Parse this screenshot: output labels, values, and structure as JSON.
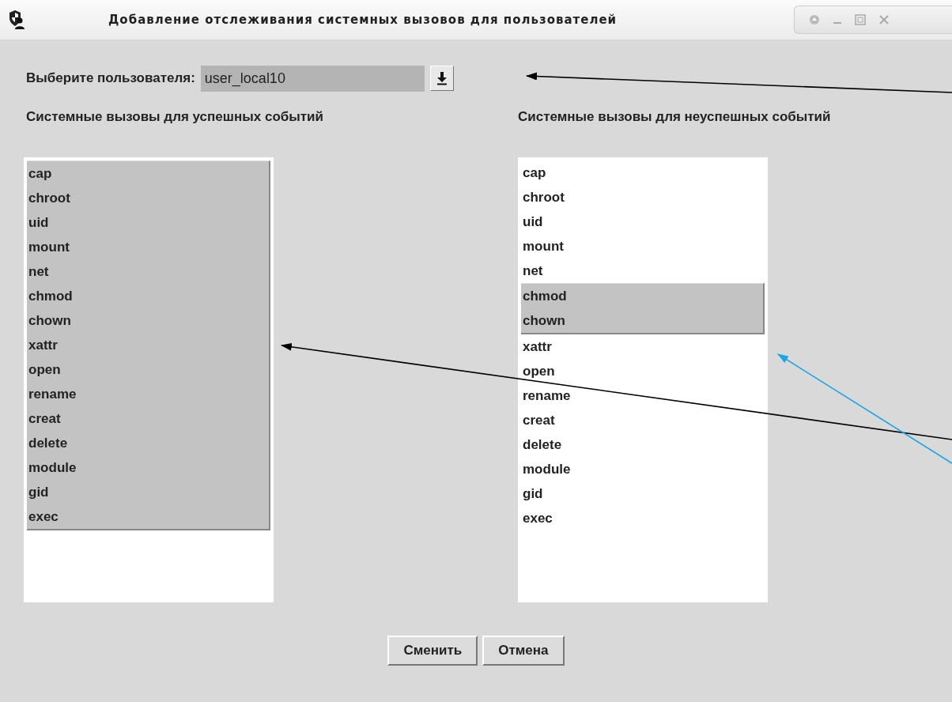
{
  "window": {
    "title": "Добавление отслеживания системных вызовов для пользователей"
  },
  "user_select": {
    "label": "Выберите пользователя:",
    "value": "user_local10"
  },
  "lists": [
    {
      "heading": "Системные вызовы для успешных событий",
      "items": [
        {
          "label": "cap",
          "selected": true
        },
        {
          "label": "chroot",
          "selected": true
        },
        {
          "label": "uid",
          "selected": true
        },
        {
          "label": "mount",
          "selected": true
        },
        {
          "label": "net",
          "selected": true
        },
        {
          "label": "chmod",
          "selected": true
        },
        {
          "label": "chown",
          "selected": true
        },
        {
          "label": "xattr",
          "selected": true
        },
        {
          "label": "open",
          "selected": true
        },
        {
          "label": "rename",
          "selected": true
        },
        {
          "label": "creat",
          "selected": true
        },
        {
          "label": "delete",
          "selected": true
        },
        {
          "label": "module",
          "selected": true
        },
        {
          "label": "gid",
          "selected": true
        },
        {
          "label": "exec",
          "selected": true
        }
      ]
    },
    {
      "heading": "Системные вызовы для неуспешных событий",
      "items": [
        {
          "label": "cap",
          "selected": false
        },
        {
          "label": "chroot",
          "selected": false
        },
        {
          "label": "uid",
          "selected": false
        },
        {
          "label": "mount",
          "selected": false
        },
        {
          "label": "net",
          "selected": false
        },
        {
          "label": "chmod",
          "selected": true
        },
        {
          "label": "chown",
          "selected": true
        },
        {
          "label": "xattr",
          "selected": false
        },
        {
          "label": "open",
          "selected": false
        },
        {
          "label": "rename",
          "selected": false
        },
        {
          "label": "creat",
          "selected": false
        },
        {
          "label": "delete",
          "selected": false
        },
        {
          "label": "module",
          "selected": false
        },
        {
          "label": "gid",
          "selected": false
        },
        {
          "label": "exec",
          "selected": false
        }
      ]
    }
  ],
  "buttons": [
    "Сменить",
    "Отмена"
  ]
}
